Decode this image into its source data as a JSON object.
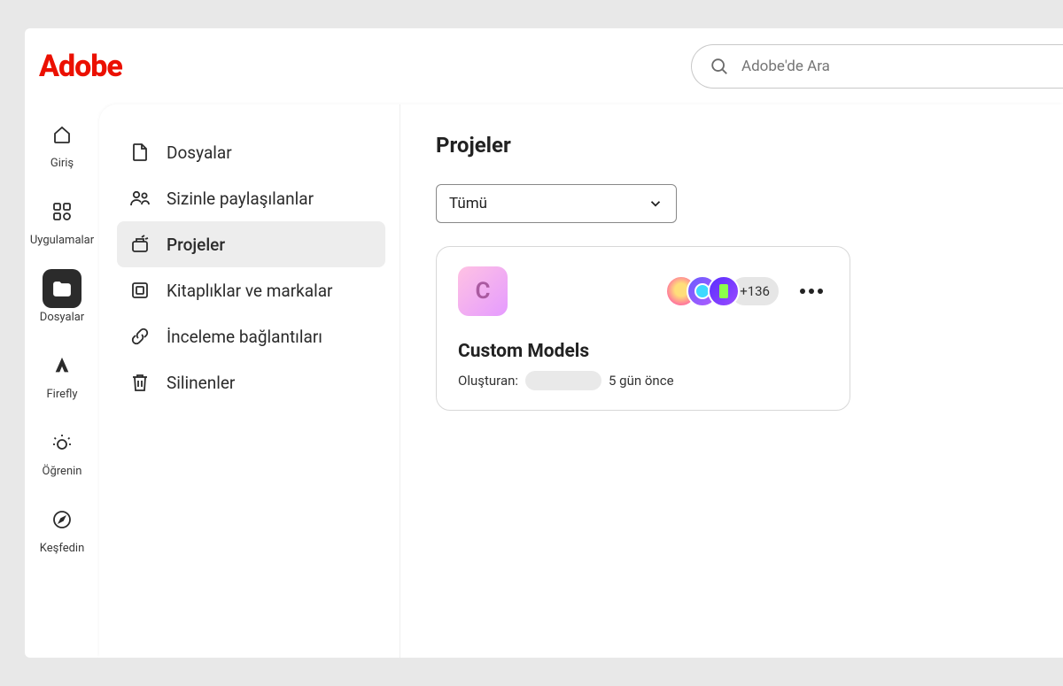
{
  "header": {
    "logo_text": "Adobe",
    "search_placeholder": "Adobe'de Ara"
  },
  "rail": [
    {
      "label": "Giriş",
      "icon": "home",
      "active": false
    },
    {
      "label": "Uygulamalar",
      "icon": "apps",
      "active": false
    },
    {
      "label": "Dosyalar",
      "icon": "folder",
      "active": true
    },
    {
      "label": "Firefly",
      "icon": "firefly",
      "active": false
    },
    {
      "label": "Öğrenin",
      "icon": "learn",
      "active": false
    },
    {
      "label": "Keşfedin",
      "icon": "compass",
      "active": false
    }
  ],
  "subnav": [
    {
      "label": "Dosyalar",
      "icon": "file",
      "active": false
    },
    {
      "label": "Sizinle paylaşılanlar",
      "icon": "shared",
      "active": false
    },
    {
      "label": "Projeler",
      "icon": "projects",
      "active": true
    },
    {
      "label": "Kitaplıklar ve markalar",
      "icon": "libraries",
      "active": false
    },
    {
      "label": "İnceleme bağlantıları",
      "icon": "link",
      "active": false
    },
    {
      "label": "Silinenler",
      "icon": "trash",
      "active": false
    }
  ],
  "main": {
    "title": "Projeler",
    "filter_selected": "Tümü",
    "project": {
      "thumb_letter": "C",
      "avatars_visible": 3,
      "more_count": "+136",
      "title": "Custom Models",
      "created_by_label": "Oluşturan:",
      "age": "5 gün önce"
    }
  }
}
